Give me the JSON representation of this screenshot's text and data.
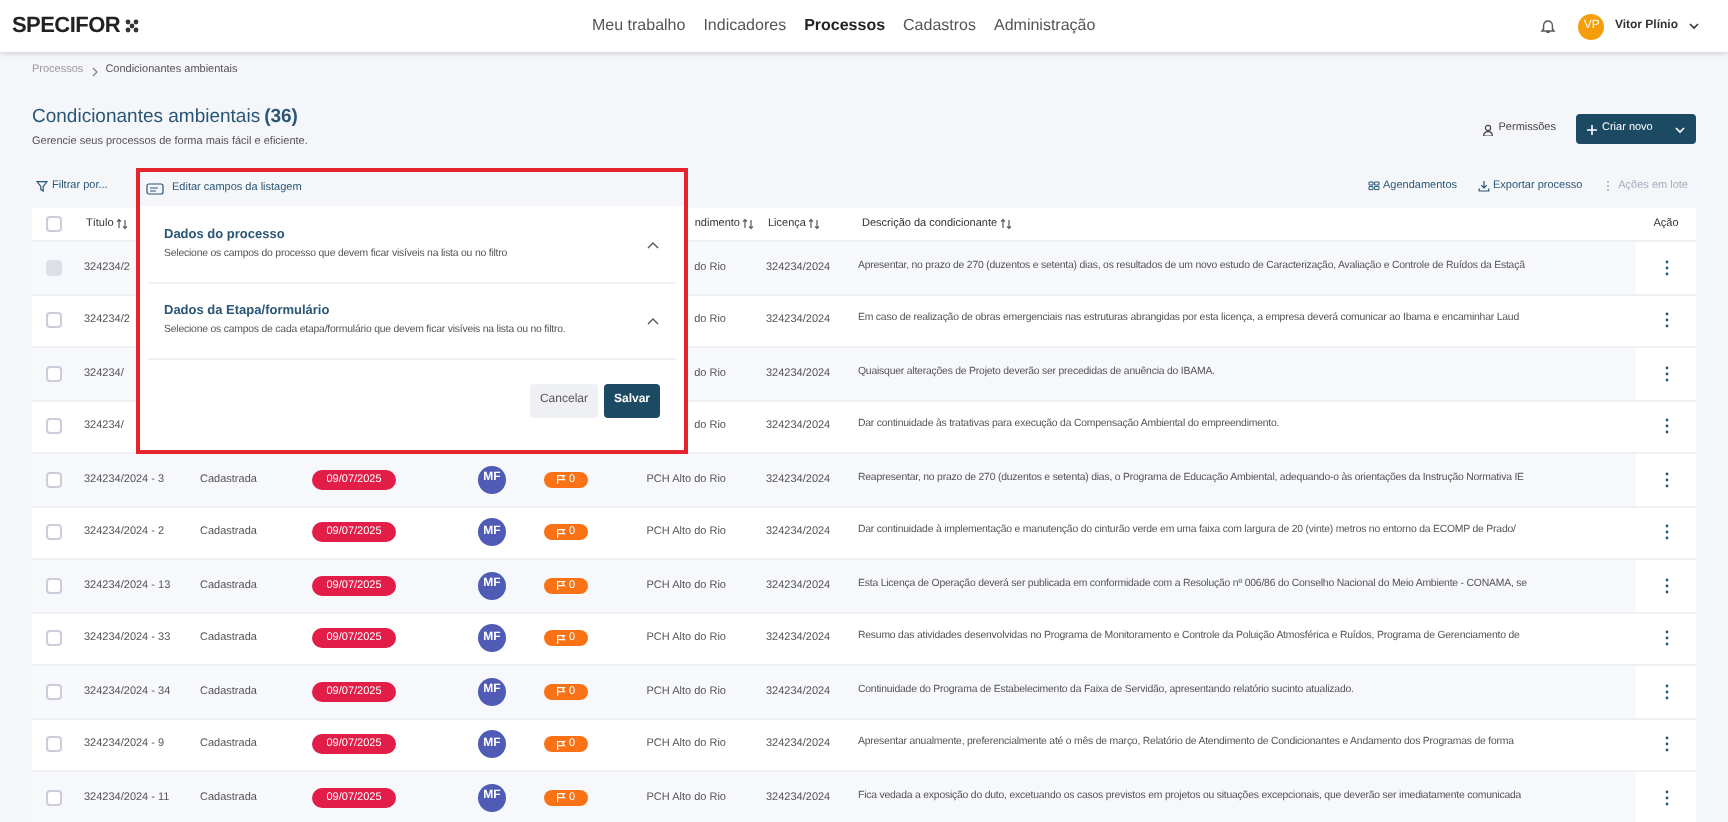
{
  "header": {
    "logo": "SPECIFOR",
    "nav": [
      {
        "label": "Meu trabalho",
        "selected": false
      },
      {
        "label": "Indicadores",
        "selected": false
      },
      {
        "label": "Processos",
        "selected": true
      },
      {
        "label": "Cadastros",
        "selected": false
      },
      {
        "label": "Administração",
        "selected": false
      }
    ],
    "user": {
      "initials": "VP",
      "name": "Vitor Plínio"
    }
  },
  "breadcrumb": [
    "Processos",
    "Condicionantes ambientais"
  ],
  "page": {
    "title": "Condicionantes ambientais",
    "count": "(36)",
    "subtitle": "Gerencie seus processos de forma mais fácil e eficiente."
  },
  "actions": {
    "permissions": "Permissões",
    "create": "Criar novo"
  },
  "toolbar": {
    "filter": "Filtrar por...",
    "right": [
      {
        "label": "Agendamentos",
        "kind": "schedule",
        "disabled": false
      },
      {
        "label": "Exportar processo",
        "kind": "export",
        "disabled": false
      },
      {
        "label": "Ações em lote",
        "kind": "batch",
        "disabled": true
      }
    ]
  },
  "popup": {
    "trigger": "Editar campos da listagem",
    "sections": [
      {
        "title": "Dados do processo",
        "description": "Selecione os campos do processo que devem ficar visíveis na lista ou no filtro",
        "expanded": true
      },
      {
        "title": "Dados da Etapa/formulário",
        "description": "Selecione os campos de cada etapa/formulário que devem ficar visíveis na lista ou no filtro.",
        "expanded": true
      }
    ],
    "buttons": [
      {
        "label": "Cancelar",
        "kind": "secondary"
      },
      {
        "label": "Salvar",
        "kind": "primary"
      }
    ]
  },
  "table": {
    "select_all": {
      "checked": false
    },
    "columns": [
      {
        "kind": "title",
        "label": "Título",
        "sortable": true
      },
      {
        "kind": "project",
        "label": "ndimento",
        "sortable": true
      },
      {
        "kind": "license",
        "label": "Licença",
        "sortable": true
      },
      {
        "kind": "description",
        "label": "Descrição da condicionante",
        "sortable": true
      },
      {
        "kind": "action",
        "label": "Ação",
        "sortable": false
      }
    ],
    "rows": [
      {
        "disabled": true,
        "title": "324234/2",
        "project": "do Rio",
        "license": "324234/2024",
        "description": "Apresentar, no prazo de 270 (duzentos e setenta) dias, os resultados de um novo estudo de Caracterização, Avaliação e Controle de Ruídos da Estaçã"
      },
      {
        "disabled": false,
        "title": "324234/2",
        "project": "do Rio",
        "license": "324234/2024",
        "description": "Em caso de realização de obras emergenciais nas estruturas abrangidas por esta licença, a empresa deverá comunicar ao Ibama e encaminhar Laud"
      },
      {
        "disabled": false,
        "title": "324234/",
        "project": "do Rio",
        "license": "324234/2024",
        "description": "Quaisquer alterações de Projeto deverão ser precedidas de anuência do IBAMA."
      },
      {
        "disabled": false,
        "title": "324234/",
        "project": "do Rio",
        "license": "324234/2024",
        "description": "Dar continuidade às tratativas para execução da Compensação Ambiental do empreendimento."
      },
      {
        "disabled": false,
        "title": "324234/2024 - 3",
        "status": "Cadastrada",
        "date": "09/07/2025",
        "assignee": "MF",
        "count": "0",
        "project": "PCH Alto do Rio",
        "license": "324234/2024",
        "description": "Reapresentar, no prazo de 270 (duzentos e setenta) dias, o Programa de Educação Ambiental, adequando-o às orientações da Instrução Normativa IE"
      },
      {
        "disabled": false,
        "title": "324234/2024 - 2",
        "status": "Cadastrada",
        "date": "09/07/2025",
        "assignee": "MF",
        "count": "0",
        "project": "PCH Alto do Rio",
        "license": "324234/2024",
        "description": "Dar continuidade à implementação e manutenção do cinturão verde em uma faixa com largura de 20 (vinte) metros no entorno da ECOMP de Prado/"
      },
      {
        "disabled": false,
        "title": "324234/2024 - 13",
        "status": "Cadastrada",
        "date": "09/07/2025",
        "assignee": "MF",
        "count": "0",
        "project": "PCH Alto do Rio",
        "license": "324234/2024",
        "description": "Esta Licença de Operação deverá ser publicada em conformidade com a Resolução nº 006/86 do Conselho Nacional do Meio Ambiente - CONAMA, se"
      },
      {
        "disabled": false,
        "title": "324234/2024 - 33",
        "status": "Cadastrada",
        "date": "09/07/2025",
        "assignee": "MF",
        "count": "0",
        "project": "PCH Alto do Rio",
        "license": "324234/2024",
        "description": "Resumo das atividades desenvolvidas no Programa de Monitoramento e Controle da Poluição Atmosférica e Ruídos, Programa de Gerenciamento de"
      },
      {
        "disabled": false,
        "title": "324234/2024 - 34",
        "status": "Cadastrada",
        "date": "09/07/2025",
        "assignee": "MF",
        "count": "0",
        "project": "PCH Alto do Rio",
        "license": "324234/2024",
        "description": "Continuidade do Programa de Estabelecimento da Faixa de Servidão, apresentando relatório sucinto atualizado."
      },
      {
        "disabled": false,
        "title": "324234/2024 - 9",
        "status": "Cadastrada",
        "date": "09/07/2025",
        "assignee": "MF",
        "count": "0",
        "project": "PCH Alto do Rio",
        "license": "324234/2024",
        "description": "Apresentar anualmente, preferencialmente até o mês de março, Relatório de Atendimento de Condicionantes e Andamento dos Programas de forma"
      },
      {
        "disabled": false,
        "title": "324234/2024 - 11",
        "status": "Cadastrada",
        "date": "09/07/2025",
        "assignee": "MF",
        "count": "0",
        "project": "PCH Alto do Rio",
        "license": "324234/2024",
        "description": "Fica vedada a exposição do duto, excetuando os casos previstos em projetos ou situações excepcionais, que deverão ser imediatamente comunicada"
      }
    ]
  }
}
